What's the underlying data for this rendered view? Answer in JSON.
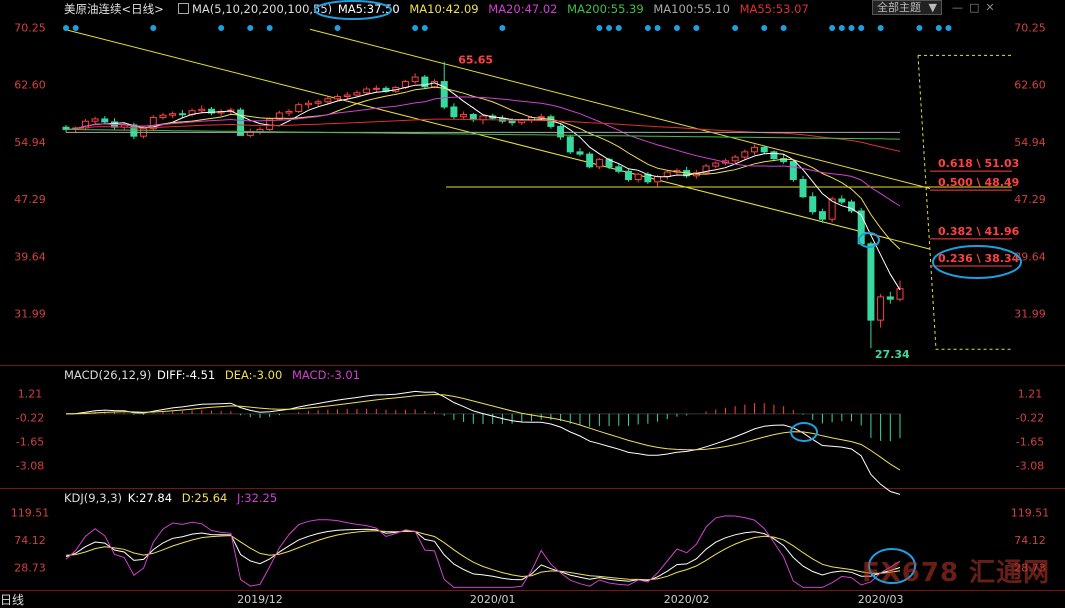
{
  "header": {
    "instrument": "美原油连续",
    "period": "<日线>",
    "ma_params": "MA(5,10,20,200,100,55)",
    "ma5": "MA5:37.50",
    "ma10": "MA10:42.09",
    "ma20": "MA20:47.02",
    "ma200": "MA200:55.39",
    "ma100": "MA100:55.10",
    "ma55": "MA55:53.07",
    "theme_label": "全部主题"
  },
  "colors": {
    "up": "#ff4040",
    "down": "#38d9a0",
    "ma5": "#ffffff",
    "ma10": "#f0e050",
    "ma20": "#d040d0",
    "ma200": "#40c040",
    "ma100": "#aaaaaa",
    "ma55": "#e03030",
    "channel": "#e8e030",
    "highlight": "#1ea0e0",
    "axis_text": "#d04040",
    "grid": "#7a1515"
  },
  "chart_data": [
    {
      "type": "candlestick",
      "title": "美原油连续<日线>",
      "ylim": [
        25.5,
        71.5
      ],
      "y_ticks": [
        "70.25",
        "62.60",
        "54.94",
        "47.29",
        "39.64",
        "31.99"
      ],
      "x_ticks": [
        "2019/12",
        "2020/01",
        "2020/02",
        "2020/03"
      ],
      "annotations": {
        "high": "65.65",
        "low": "27.34"
      },
      "fib_levels": [
        {
          "label": "0.618 \\ 51.03",
          "value": 51.03
        },
        {
          "label": "0.500 \\ 48.49",
          "value": 48.49
        },
        {
          "label": "0.382 \\ 41.96",
          "value": 41.96
        },
        {
          "label": "0.236 \\ 38.34",
          "value": 38.34
        }
      ],
      "candles": [
        [
          56.9,
          57.2,
          56.2,
          56.6
        ],
        [
          56.6,
          57.0,
          56.1,
          56.8
        ],
        [
          56.8,
          58.0,
          56.5,
          57.7
        ],
        [
          57.7,
          58.3,
          57.2,
          58.0
        ],
        [
          58.0,
          58.4,
          57.3,
          57.6
        ],
        [
          57.6,
          58.1,
          56.6,
          56.9
        ],
        [
          56.9,
          57.5,
          56.5,
          57.2
        ],
        [
          57.2,
          57.5,
          55.3,
          55.7
        ],
        [
          55.7,
          57.0,
          55.4,
          56.7
        ],
        [
          56.7,
          58.5,
          56.4,
          58.2
        ],
        [
          58.2,
          58.8,
          57.9,
          58.5
        ],
        [
          58.5,
          59.0,
          58.1,
          58.7
        ],
        [
          58.7,
          59.2,
          58.2,
          58.6
        ],
        [
          58.6,
          59.4,
          58.3,
          59.1
        ],
        [
          59.1,
          59.8,
          58.8,
          59.3
        ],
        [
          59.3,
          59.6,
          58.5,
          58.8
        ],
        [
          58.8,
          59.3,
          58.4,
          59.0
        ],
        [
          59.0,
          59.5,
          58.6,
          59.2
        ],
        [
          59.2,
          59.5,
          56.3,
          55.8
        ],
        [
          55.8,
          56.7,
          55.5,
          56.3
        ],
        [
          56.3,
          56.9,
          55.9,
          56.6
        ],
        [
          56.6,
          58.2,
          56.4,
          58.0
        ],
        [
          58.0,
          59.1,
          57.8,
          58.8
        ],
        [
          58.8,
          59.3,
          58.4,
          59.0
        ],
        [
          59.0,
          60.2,
          58.8,
          59.9
        ],
        [
          59.9,
          60.5,
          59.4,
          60.1
        ],
        [
          60.1,
          60.6,
          59.7,
          60.3
        ],
        [
          60.3,
          61.0,
          60.0,
          60.7
        ],
        [
          60.7,
          61.3,
          60.4,
          61.0
        ],
        [
          61.0,
          61.6,
          60.6,
          61.2
        ],
        [
          61.2,
          61.8,
          60.9,
          61.5
        ],
        [
          61.5,
          62.3,
          61.2,
          62.0
        ],
        [
          62.0,
          62.5,
          61.6,
          62.1
        ],
        [
          62.1,
          62.4,
          61.5,
          61.7
        ],
        [
          61.7,
          62.4,
          61.5,
          62.2
        ],
        [
          62.2,
          63.2,
          62.0,
          63.0
        ],
        [
          63.0,
          64.1,
          62.7,
          63.6
        ],
        [
          63.6,
          63.9,
          62.0,
          62.3
        ],
        [
          62.3,
          63.3,
          62.1,
          63.0
        ],
        [
          63.0,
          65.65,
          59.3,
          59.6
        ],
        [
          59.6,
          60.1,
          58.0,
          58.3
        ],
        [
          58.3,
          59.0,
          58.0,
          58.6
        ],
        [
          58.6,
          58.8,
          57.6,
          57.9
        ],
        [
          57.9,
          58.6,
          57.3,
          58.4
        ],
        [
          58.4,
          58.7,
          57.8,
          58.1
        ],
        [
          58.1,
          58.5,
          57.4,
          57.7
        ],
        [
          57.7,
          58.1,
          57.1,
          57.5
        ],
        [
          57.5,
          58.0,
          57.2,
          57.8
        ],
        [
          57.8,
          58.4,
          57.5,
          58.2
        ],
        [
          58.2,
          58.7,
          57.9,
          58.3
        ],
        [
          58.3,
          58.6,
          56.7,
          57.0
        ],
        [
          57.0,
          57.3,
          55.2,
          55.6
        ],
        [
          55.6,
          55.9,
          53.3,
          53.6
        ],
        [
          53.6,
          54.1,
          53.0,
          53.3
        ],
        [
          53.3,
          53.6,
          51.4,
          51.6
        ],
        [
          51.6,
          52.8,
          51.3,
          52.6
        ],
        [
          52.6,
          52.8,
          51.3,
          51.6
        ],
        [
          51.6,
          52.0,
          50.7,
          51.0
        ],
        [
          51.0,
          51.3,
          49.6,
          49.9
        ],
        [
          49.9,
          50.8,
          49.5,
          50.6
        ],
        [
          50.6,
          50.9,
          49.3,
          49.6
        ],
        [
          49.6,
          50.5,
          49.0,
          50.3
        ],
        [
          50.3,
          51.2,
          49.9,
          50.9
        ],
        [
          50.9,
          51.4,
          50.6,
          51.1
        ],
        [
          51.1,
          51.6,
          50.1,
          50.4
        ],
        [
          50.4,
          51.2,
          50.0,
          50.8
        ],
        [
          50.8,
          52.0,
          50.6,
          51.7
        ],
        [
          51.7,
          52.3,
          51.4,
          52.1
        ],
        [
          52.1,
          52.7,
          51.8,
          52.4
        ],
        [
          52.4,
          53.2,
          52.1,
          52.9
        ],
        [
          52.9,
          53.9,
          52.6,
          53.6
        ],
        [
          53.6,
          54.6,
          53.2,
          54.2
        ],
        [
          54.2,
          54.5,
          53.3,
          53.6
        ],
        [
          53.6,
          53.8,
          52.4,
          52.7
        ],
        [
          52.7,
          53.3,
          52.0,
          52.3
        ],
        [
          52.3,
          52.5,
          49.6,
          49.9
        ],
        [
          49.9,
          50.4,
          47.4,
          47.6
        ],
        [
          47.6,
          48.2,
          45.2,
          45.6
        ],
        [
          45.6,
          46.0,
          44.1,
          44.6
        ],
        [
          44.6,
          47.6,
          44.2,
          47.3
        ],
        [
          47.3,
          47.8,
          46.6,
          46.9
        ],
        [
          46.9,
          47.2,
          45.4,
          45.7
        ],
        [
          45.7,
          46.1,
          41.1,
          41.3
        ],
        [
          41.3,
          41.6,
          27.34,
          31.1
        ],
        [
          31.1,
          34.6,
          30.1,
          34.2
        ],
        [
          34.2,
          34.9,
          33.3,
          33.9
        ],
        [
          33.9,
          36.4,
          33.6,
          35.3
        ]
      ]
    },
    {
      "type": "bar_line",
      "title": "MACD(26,12,9)",
      "labels": {
        "diff": "DIFF:-4.51",
        "dea": "DEA:-3.00",
        "macd": "MACD:-3.01"
      },
      "ylim": [
        -4.3,
        1.9
      ],
      "y_ticks": [
        "1.21",
        "-0.22",
        "-1.65",
        "-3.08"
      ]
    },
    {
      "type": "line",
      "title": "KDJ(9,3,3)",
      "labels": {
        "k": "K:27.84",
        "d": "D:25.64",
        "j": "J:32.25"
      },
      "ylim": [
        -5,
        135
      ],
      "y_ticks": [
        "119.51",
        "74.12",
        "28.73"
      ]
    }
  ],
  "footer": {
    "period_tab": "日线"
  },
  "watermark": "FX678 汇通网"
}
